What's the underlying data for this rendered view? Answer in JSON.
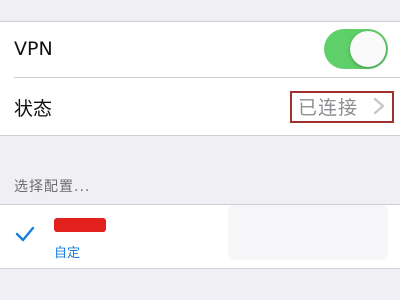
{
  "vpn_row": {
    "label": "VPN",
    "toggle_on": true,
    "toggle_color": "#5fcf6a"
  },
  "status_row": {
    "label": "状态",
    "value": "已连接",
    "highlight_color": "#a0302d"
  },
  "config_section": {
    "header": "选择配置...",
    "items": [
      {
        "type_label": "自定",
        "selected": true,
        "selected_color": "#1a7fd9"
      }
    ]
  }
}
